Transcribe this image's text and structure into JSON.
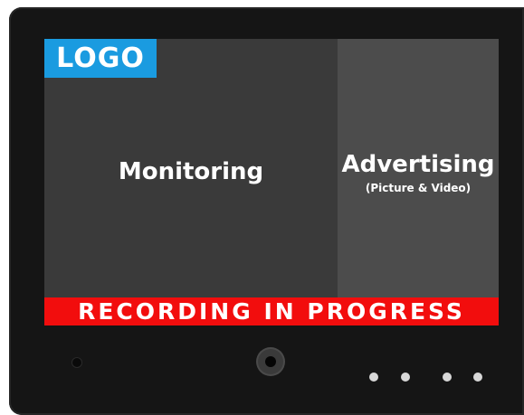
{
  "screen": {
    "logo": "LOGO",
    "monitoring_label": "Monitoring",
    "advertising_title": "Advertising",
    "advertising_subtitle": "(Picture & Video)",
    "banner": "RECORDING IN PROGRESS"
  },
  "colors": {
    "logo_bg": "#1a9be0",
    "banner_bg": "#f20d0d",
    "bezel": "#151515"
  },
  "hardware": {
    "sensor_icon": "sensor-icon",
    "camera_icon": "camera-lens-icon",
    "indicator_icon": "indicator-light-icon",
    "indicator_count": 4
  }
}
